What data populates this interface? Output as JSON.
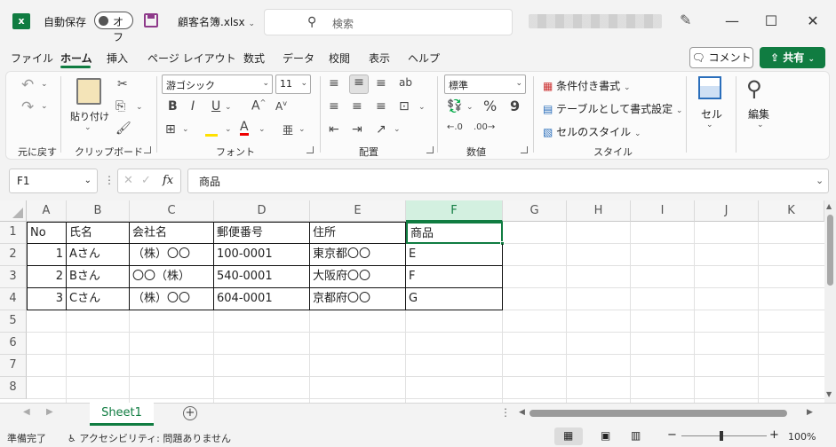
{
  "titlebar": {
    "autosave_label": "自動保存",
    "toggle_state": "オフ",
    "filename": "顧客名簿.xlsx",
    "search_placeholder": "検索"
  },
  "menu": {
    "items": [
      "ファイル",
      "ホーム",
      "挿入",
      "ページ レイアウト",
      "数式",
      "データ",
      "校閲",
      "表示",
      "ヘルプ"
    ],
    "active": "ホーム",
    "comment_label": "コメント",
    "share_label": "共有"
  },
  "ribbon": {
    "undo_group_label": "元に戻す",
    "paste_label": "貼り付け",
    "clipboard_group_label": "クリップボード",
    "font_name": "游ゴシック",
    "font_size": "11",
    "font_group_label": "フォント",
    "align_group_label": "配置",
    "number_format": "標準",
    "number_group_label": "数値",
    "conditional_label": "条件付き書式",
    "table_format_label": "テーブルとして書式設定",
    "cell_style_label": "セルのスタイル",
    "style_group_label": "スタイル",
    "cells_label": "セル",
    "editing_label": "編集"
  },
  "formula_bar": {
    "name_box": "F1",
    "fx": "fx",
    "content": "商品"
  },
  "grid": {
    "columns": [
      "A",
      "B",
      "C",
      "D",
      "E",
      "F",
      "G",
      "H",
      "I",
      "J",
      "K"
    ],
    "selected_column": "F",
    "rows": [
      "1",
      "2",
      "3",
      "4",
      "5",
      "6",
      "7",
      "8"
    ],
    "headers": [
      "No",
      "氏名",
      "会社名",
      "郵便番号",
      "住所",
      "商品"
    ],
    "data": [
      [
        "1",
        "Aさん",
        "（株）〇〇",
        "100-0001",
        "東京都〇〇",
        "E"
      ],
      [
        "2",
        "Bさん",
        "〇〇（株）",
        "540-0001",
        "大阪府〇〇",
        "F"
      ],
      [
        "3",
        "Cさん",
        "（株）〇〇",
        "604-0001",
        "京都府〇〇",
        "G"
      ]
    ]
  },
  "sheets": {
    "tab": "Sheet1"
  },
  "status": {
    "ready": "準備完了",
    "accessibility": "アクセシビリティ: 問題ありません",
    "zoom": "100%"
  },
  "colors": {
    "accent": "#107c41"
  }
}
